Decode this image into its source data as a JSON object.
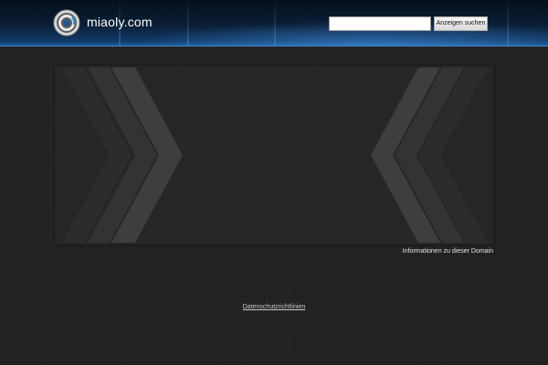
{
  "header": {
    "site_name": "miaoly.com",
    "logo_icon": "circular-logo-icon",
    "search": {
      "input_value": "",
      "input_placeholder": "",
      "button_label": "Anzeigen suchen"
    }
  },
  "banner": {
    "decoration_icons": [
      "chevron-right-icon",
      "chevron-left-icon"
    ]
  },
  "links": {
    "domain_info": "Informationen zu dieser Domain",
    "privacy": "Datenschutzrichtlinien"
  },
  "colors": {
    "background": "#222222",
    "header_blue": "#1d5796",
    "banner_background": "#262626"
  }
}
